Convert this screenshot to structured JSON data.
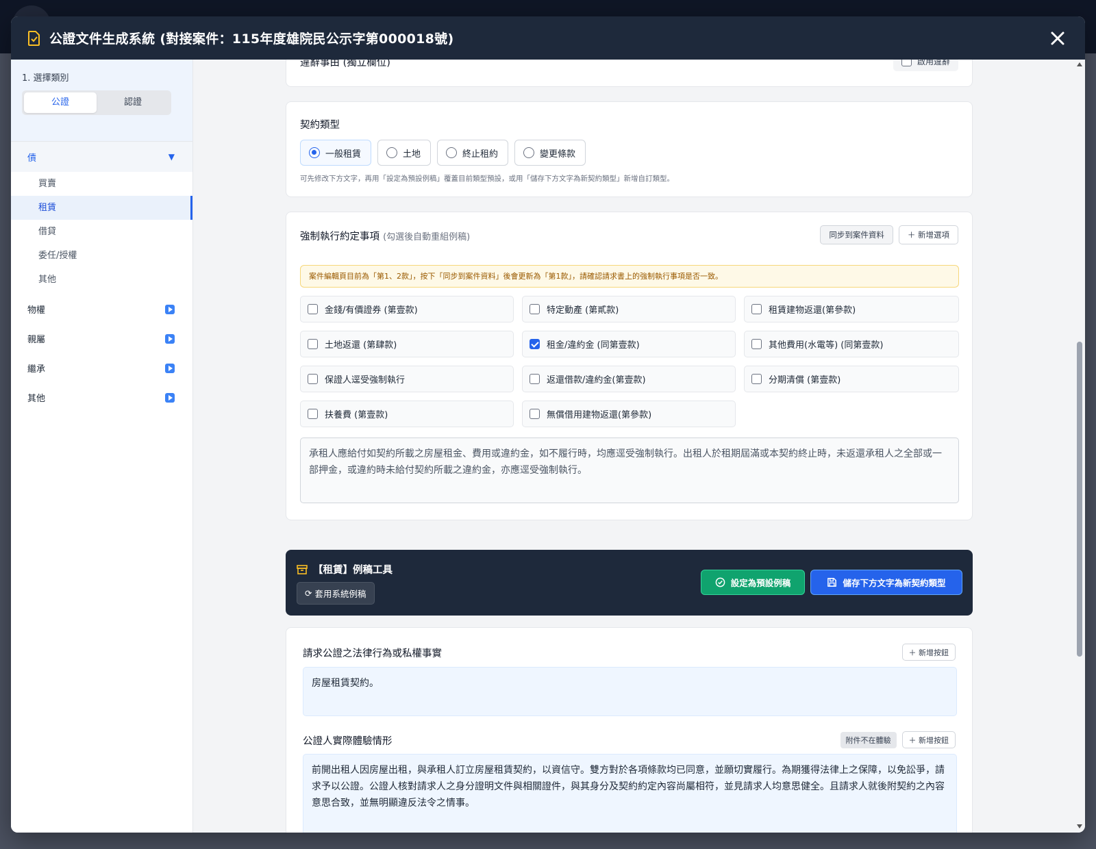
{
  "modal": {
    "title": "公證文件生成系統 (對接案件：115年度雄院民公示字第000018號)"
  },
  "sidebar": {
    "step_label": "1. 選擇類別",
    "tabs": [
      "公證",
      "認證"
    ],
    "categories": [
      {
        "label": "債",
        "subs": [
          "買賣",
          "租賃",
          "借貸",
          "委任/授權",
          "其他"
        ]
      },
      {
        "label": "物權"
      },
      {
        "label": "親屬"
      },
      {
        "label": "繼承"
      },
      {
        "label": "其他"
      }
    ],
    "active_sub": "租賃"
  },
  "top_partial": {
    "label": "違辭事由 (獨立欄位)",
    "toggle_label": "啟用違辭"
  },
  "contract_type": {
    "title": "契約類型",
    "options": [
      "一般租賃",
      "土地",
      "終止租約",
      "變更條款"
    ],
    "selected": "一般租賃",
    "hint": "可先修改下方文字，再用「設定為預設例稿」覆蓋目前類型預設，或用「儲存下方文字為新契約類型」新增自訂類型。"
  },
  "enforcement": {
    "title": "強制執行約定事項",
    "subtitle": "(勾選後自動重組例稿)",
    "sync_button": "同步到案件資料",
    "add_button": "＋ 新增選項",
    "warning": "案件編輯頁目前為「第1、2款」，按下「同步到案件資料」後會更新為「第1款」，請確認請求書上的強制執行事項是否一致。",
    "options": [
      {
        "label": "金錢/有價證券 (第壹款)",
        "checked": false
      },
      {
        "label": "特定動產 (第貳款)",
        "checked": false
      },
      {
        "label": "租賃建物返還(第參款)",
        "checked": false
      },
      {
        "label": "土地返還 (第肆款)",
        "checked": false
      },
      {
        "label": "租金/違約金 (同第壹款)",
        "checked": true
      },
      {
        "label": "其他費用(水電等) (同第壹款)",
        "checked": false
      },
      {
        "label": "保證人逕受強制執行",
        "checked": false
      },
      {
        "label": "返還借款/違約金(第壹款)",
        "checked": false
      },
      {
        "label": "分期清償 (第壹款)",
        "checked": false
      },
      {
        "label": "扶養費 (第壹款)",
        "checked": false
      },
      {
        "label": "無償借用建物返還(第參款)",
        "checked": false
      }
    ],
    "text": "承租人應給付如契約所載之房屋租金、費用或違約金，如不履行時，均應逕受強制執行。出租人於租期屆滿或本契約終止時，未返還承租人之全部或一部押金，或違約時未給付契約所載之違約金，亦應逕受強制執行。"
  },
  "template_tools": {
    "title": "【租賃】例稿工具",
    "apply_system": "套用系統例稿",
    "set_default": "設定為預設例稿",
    "save_new": "儲存下方文字為新契約類型"
  },
  "facts": {
    "section1_title": "請求公證之法律行為或私權事實",
    "section1_add": "＋ 新增按鈕",
    "section1_text": "房屋租賃契約。",
    "section2_title": "公證人實際體驗情形",
    "section2_badge": "附件不在體驗",
    "section2_add": "＋ 新增按鈕",
    "section2_text": "前開出租人因房屋出租，與承租人訂立房屋租賃契約，以資信守。雙方對於各項條款均已同意，並願切實履行。為期獲得法律上之保障，以免訟爭，請求予以公證。公證人核對請求人之身分證明文件與相關證件，與其身分及契約約定內容尚屬相符，並見請求人均意思健全。且請求人就後附契約之內容意思合致，並無明顯違反法令之情事。"
  }
}
